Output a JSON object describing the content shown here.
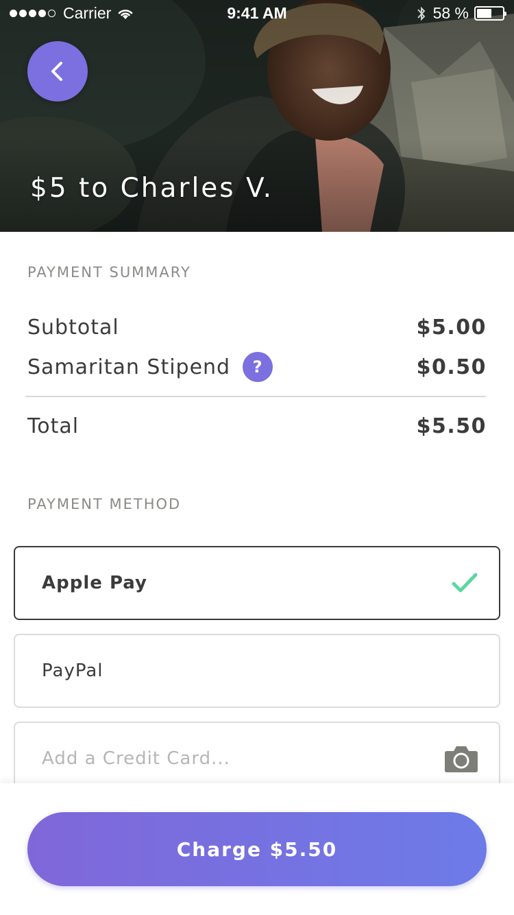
{
  "status_bar": {
    "carrier": "Carrier",
    "time": "9:41 AM",
    "battery_percent": "58 %",
    "battery_level": 0.58,
    "signal_bars": 4,
    "signal_max": 5
  },
  "hero": {
    "title": "$5 to Charles V.",
    "back_icon": "chevron-left-icon"
  },
  "summary": {
    "heading": "PAYMENT SUMMARY",
    "subtotal_label": "Subtotal",
    "subtotal_value": "$5.00",
    "stipend_label": "Samaritan Stipend",
    "stipend_help": "?",
    "stipend_value": "$0.50",
    "total_label": "Total",
    "total_value": "$5.50"
  },
  "payment": {
    "heading": "PAYMENT METHOD",
    "methods": [
      {
        "label": "Apple Pay",
        "selected": true,
        "icon": "checkmark-icon"
      },
      {
        "label": "PayPal",
        "selected": false
      },
      {
        "label": "Add a Credit Card...",
        "placeholder": true,
        "icon": "camera-icon"
      }
    ]
  },
  "cta": {
    "label": "Charge $5.50"
  },
  "colors": {
    "accent": "#7c6fe0",
    "check": "#5cd6a0",
    "text": "#3b3b3b",
    "muted": "#8a8a86"
  }
}
